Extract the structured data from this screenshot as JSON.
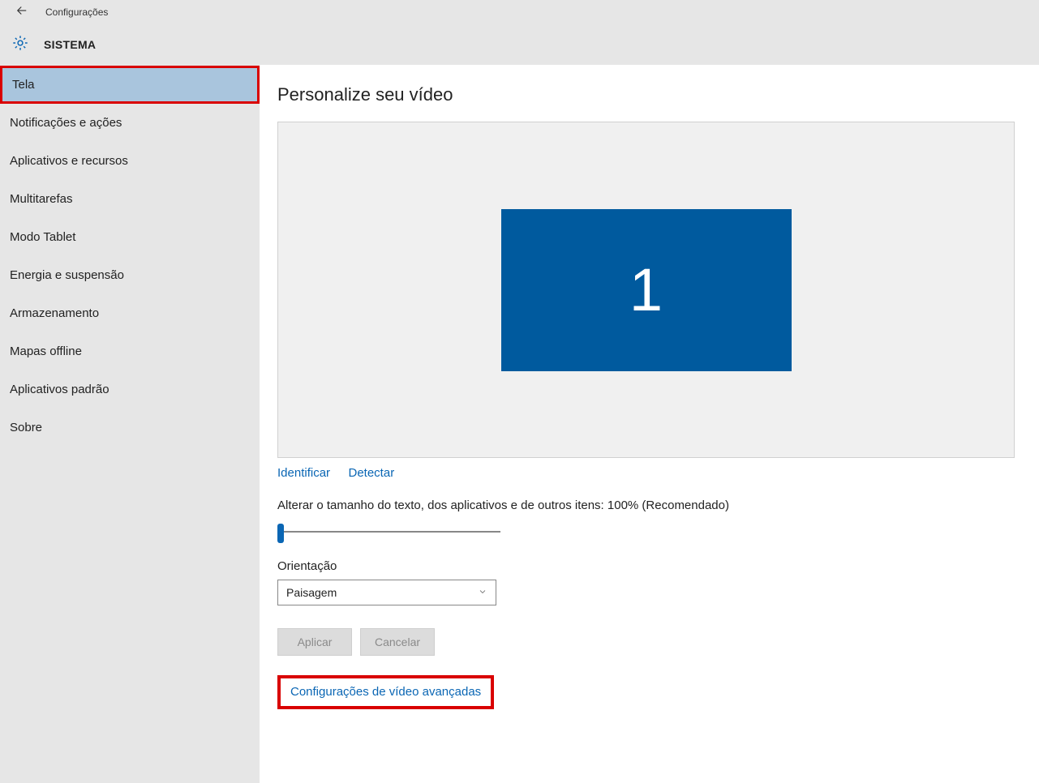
{
  "header": {
    "title": "Configurações"
  },
  "subheader": {
    "title": "SISTEMA"
  },
  "sidebar": {
    "items": [
      {
        "label": "Tela",
        "active": true
      },
      {
        "label": "Notificações e ações"
      },
      {
        "label": "Aplicativos e recursos"
      },
      {
        "label": "Multitarefas"
      },
      {
        "label": "Modo Tablet"
      },
      {
        "label": "Energia e suspensão"
      },
      {
        "label": "Armazenamento"
      },
      {
        "label": "Mapas offline"
      },
      {
        "label": "Aplicativos padrão"
      },
      {
        "label": "Sobre"
      }
    ]
  },
  "main": {
    "title": "Personalize seu vídeo",
    "monitor_number": "1",
    "identify_link": "Identificar",
    "detect_link": "Detectar",
    "scale_label": "Alterar o tamanho do texto, dos aplicativos e de outros itens: 100% (Recomendado)",
    "orientation_label": "Orientação",
    "orientation_value": "Paisagem",
    "apply_btn": "Aplicar",
    "cancel_btn": "Cancelar",
    "advanced_link": "Configurações de vídeo avançadas"
  }
}
